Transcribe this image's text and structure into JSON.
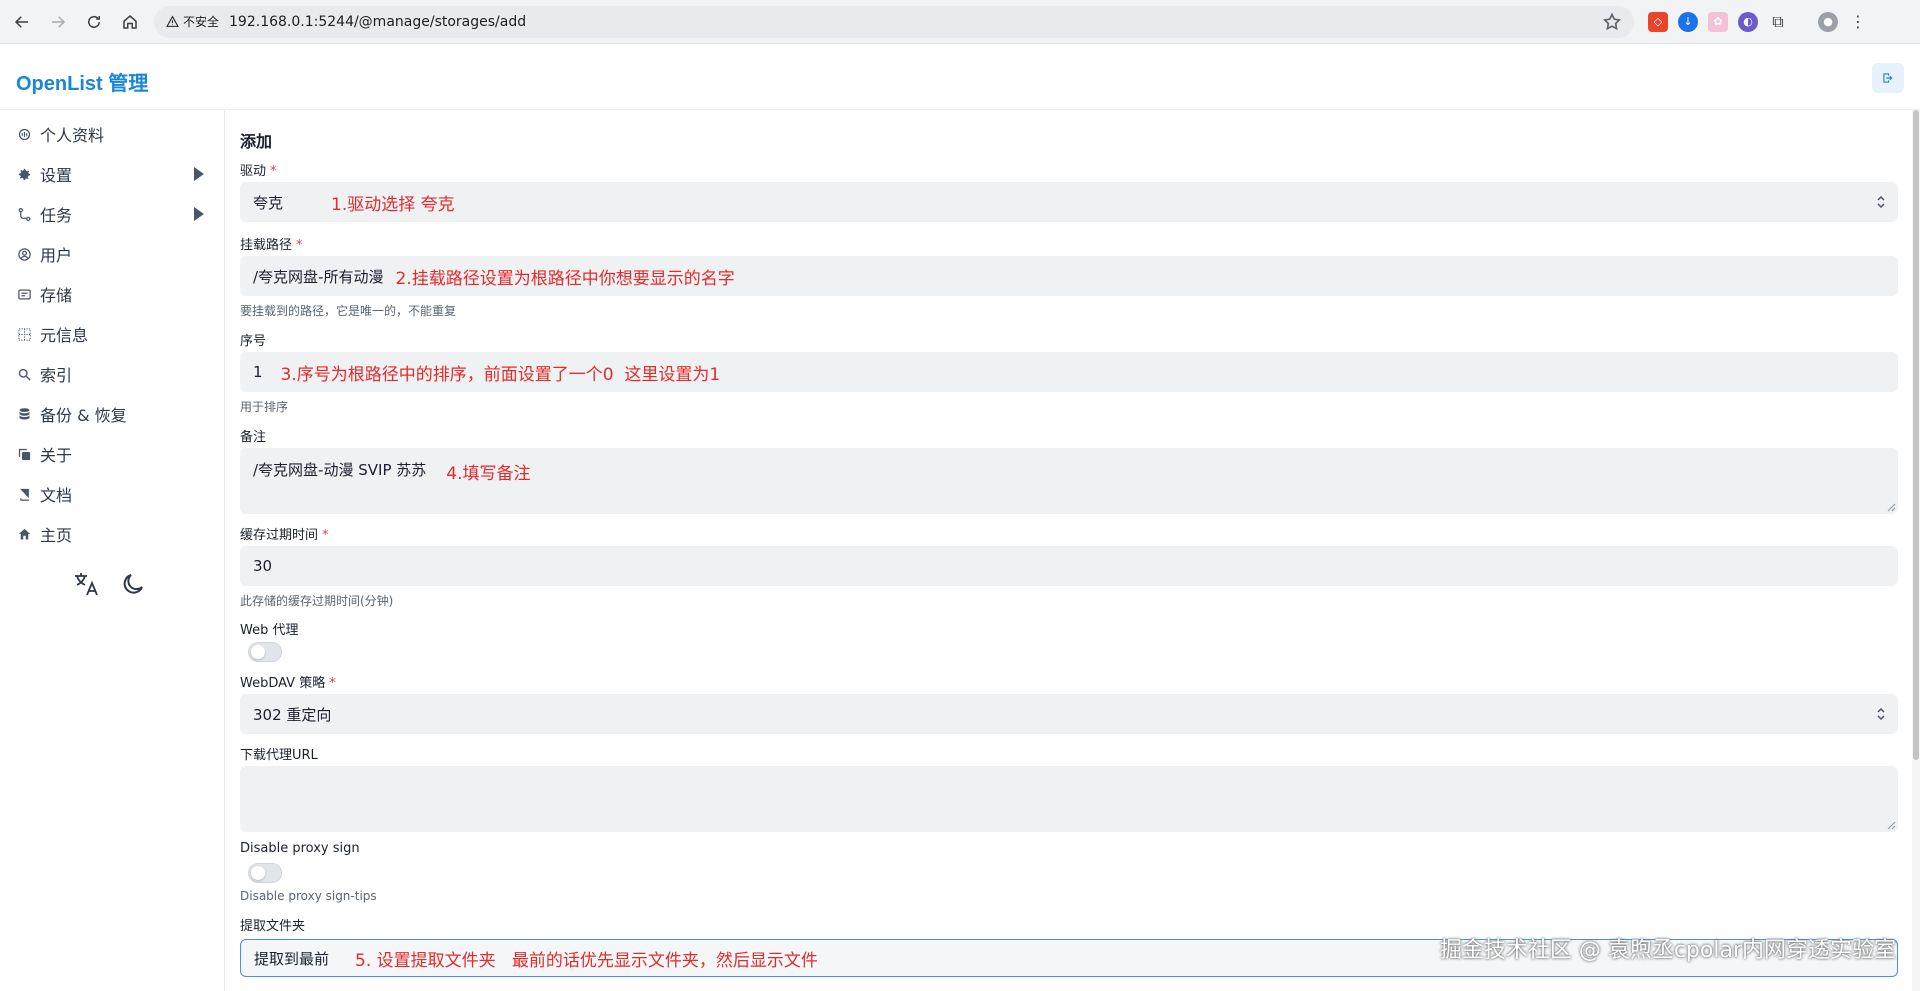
{
  "browser": {
    "insecure_label": "不安全",
    "url": "192.168.0.1:5244/@manage/storages/add"
  },
  "app": {
    "brand": "OpenList 管理"
  },
  "sidebar": {
    "items": [
      {
        "label": "个人资料",
        "icon": "fingerprint-icon"
      },
      {
        "label": "设置",
        "icon": "gear-icon",
        "expandable": true
      },
      {
        "label": "任务",
        "icon": "workflow-icon",
        "expandable": true
      },
      {
        "label": "用户",
        "icon": "user-circle-icon"
      },
      {
        "label": "存储",
        "icon": "storage-icon"
      },
      {
        "label": "元信息",
        "icon": "meta-icon"
      },
      {
        "label": "索引",
        "icon": "search-icon"
      },
      {
        "label": "备份 & 恢复",
        "icon": "database-icon"
      },
      {
        "label": "关于",
        "icon": "copy-icon"
      },
      {
        "label": "文档",
        "icon": "book-icon"
      },
      {
        "label": "主页",
        "icon": "home-icon"
      }
    ]
  },
  "form": {
    "heading": "添加",
    "driver": {
      "label": "驱动",
      "value": "夸克",
      "annotation": "1.驱动选择 夸克"
    },
    "mount_path": {
      "label": "挂载路径",
      "value": "/夸克网盘-所有动漫",
      "annotation": "2.挂载路径设置为根路径中你想要显示的名字",
      "help": "要挂载到的路径，它是唯一的，不能重复"
    },
    "order": {
      "label": "序号",
      "value": "1",
      "annotation": "3.序号为根路径中的排序，前面设置了一个0  这里设置为1",
      "help": "用于排序"
    },
    "remark": {
      "label": "备注",
      "value": "/夸克网盘-动漫  SVIP 苏苏",
      "annotation": "4.填写备注"
    },
    "cache_expiration": {
      "label": "缓存过期时间",
      "value": "30",
      "help": "此存储的缓存过期时间(分钟)"
    },
    "web_proxy": {
      "label": "Web 代理",
      "enabled": false
    },
    "webdav_policy": {
      "label": "WebDAV 策略",
      "value": "302 重定向"
    },
    "download_proxy_url": {
      "label": "下载代理URL",
      "value": ""
    },
    "disable_proxy_sign": {
      "label": "Disable proxy sign",
      "enabled": false,
      "help": "Disable proxy sign-tips"
    },
    "extract_folder": {
      "label": "提取文件夹",
      "value": "提取到最前",
      "annotation": "5. 设置提取文件夹   最前的话优先显示文件夹，然后显示文件"
    }
  },
  "watermark": "掘金技术社区 @ 袁煦丞cpolar内网穿透实验室",
  "colors": {
    "brand": "#1c86d6",
    "annotation": "#e32b2b",
    "required": "#e53e3e"
  }
}
